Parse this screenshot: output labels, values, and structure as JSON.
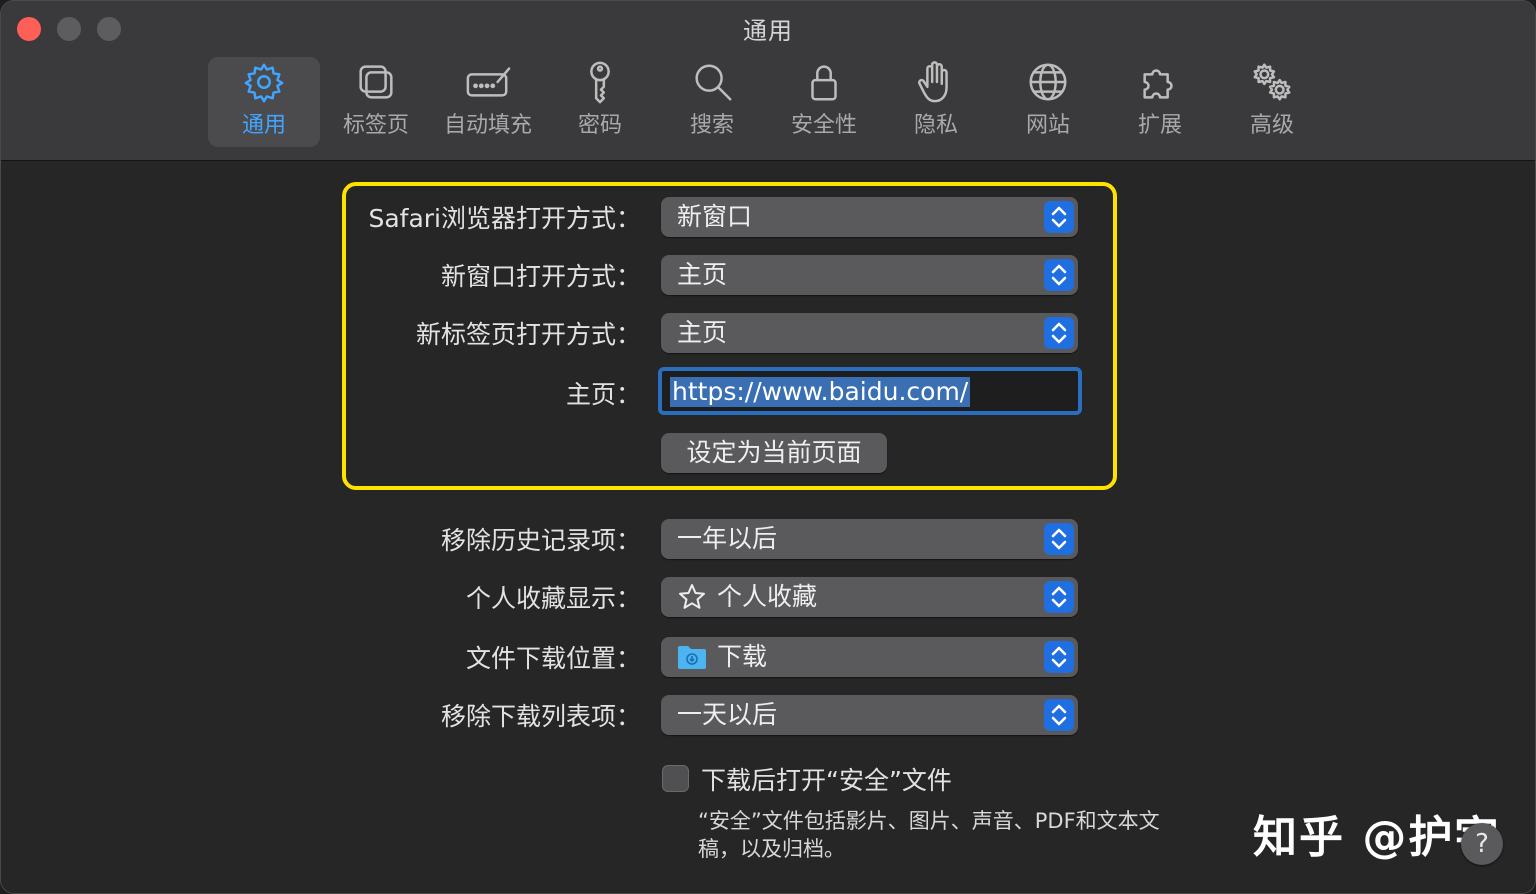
{
  "window": {
    "title": "通用"
  },
  "tabs": [
    {
      "label": "通用",
      "icon": "gear-icon",
      "active": true
    },
    {
      "label": "标签页",
      "icon": "tabs-icon"
    },
    {
      "label": "自动填充",
      "icon": "autofill-icon"
    },
    {
      "label": "密码",
      "icon": "key-icon"
    },
    {
      "label": "搜索",
      "icon": "search-icon"
    },
    {
      "label": "安全性",
      "icon": "lock-icon"
    },
    {
      "label": "隐私",
      "icon": "hand-icon"
    },
    {
      "label": "网站",
      "icon": "globe-icon"
    },
    {
      "label": "扩展",
      "icon": "puzzle-icon"
    },
    {
      "label": "高级",
      "icon": "gears-icon"
    }
  ],
  "settings": {
    "safari_open": {
      "label": "Safari浏览器打开方式：",
      "value": "新窗口"
    },
    "new_window": {
      "label": "新窗口打开方式：",
      "value": "主页"
    },
    "new_tab": {
      "label": "新标签页打开方式：",
      "value": "主页"
    },
    "homepage": {
      "label": "主页：",
      "value": "https://www.baidu.com/"
    },
    "set_current": {
      "label": "设定为当前页面"
    },
    "remove_history": {
      "label": "移除历史记录项：",
      "value": "一年以后"
    },
    "favorites": {
      "label": "个人收藏显示：",
      "value": "个人收藏",
      "icon": "star-icon"
    },
    "download_location": {
      "label": "文件下载位置：",
      "value": "下载",
      "icon": "folder-icon"
    },
    "remove_downloads": {
      "label": "移除下载列表项：",
      "value": "一天以后"
    },
    "open_safe": {
      "label": "下载后打开“安全”文件",
      "checked": false,
      "help": "“安全”文件包括影片、图片、声音、PDF和文本文稿，以及归档。"
    }
  },
  "watermark": "知乎 @护宇",
  "help_button": "?",
  "colors": {
    "accent": "#41a5ff",
    "highlight": "#ffe100",
    "stepper": "#1f6fe0"
  }
}
